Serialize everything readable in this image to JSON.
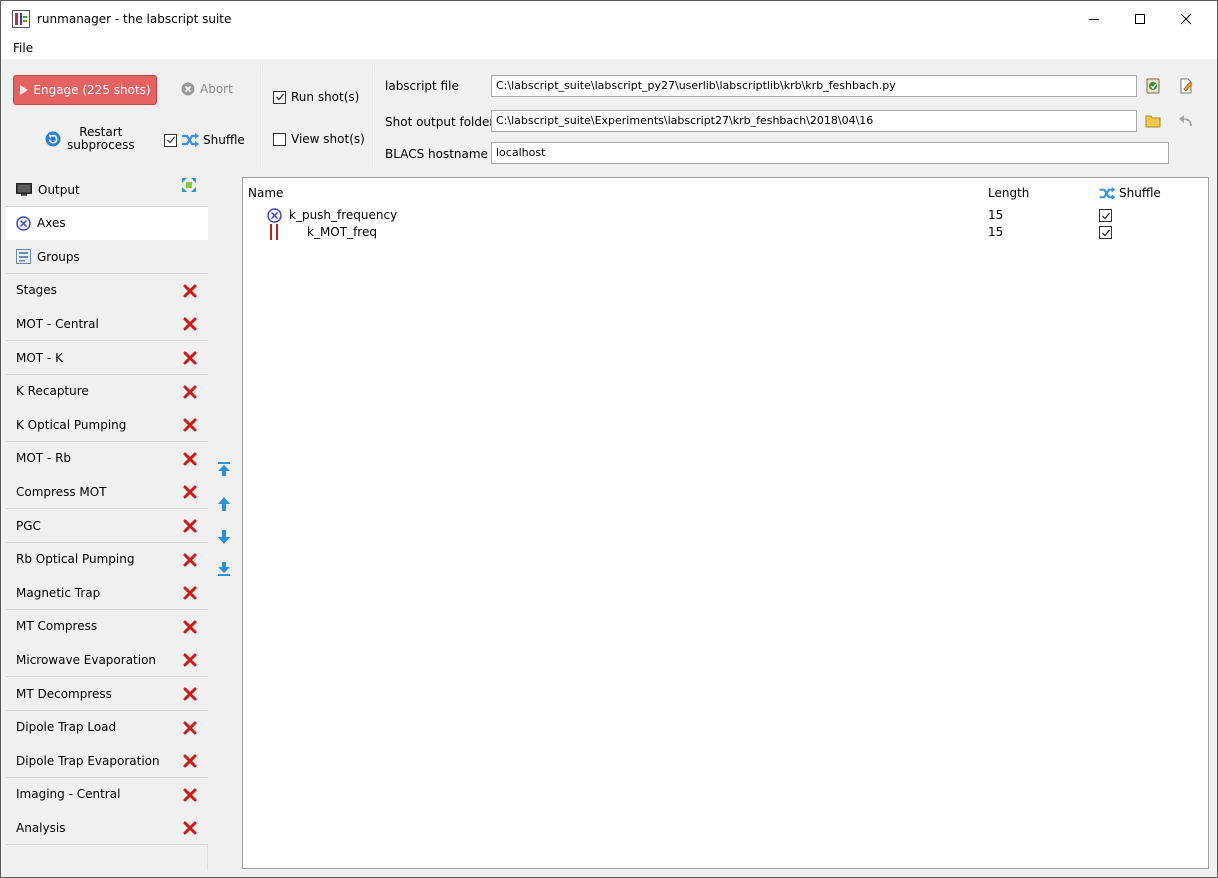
{
  "window": {
    "title": "runmanager - the labscript suite",
    "controls": [
      "minimize",
      "maximize",
      "close"
    ]
  },
  "menu": {
    "file": "File"
  },
  "toolbar": {
    "engage_label": "Engage (225 shots)",
    "abort_label": "Abort",
    "restart_label_line1": "Restart",
    "restart_label_line2": "subprocess",
    "shuffle_label": "Shuffle",
    "shuffle_checked": true,
    "run_shots_label": "Run shot(s)",
    "run_shots_checked": true,
    "view_shots_label": "View shot(s)",
    "view_shots_checked": false
  },
  "settings": {
    "labscript_file_label": "labscript file",
    "labscript_file_value": "C:\\labscript_suite\\labscript_py27\\userlib\\labscriptlib\\krb\\krb_feshbach.py",
    "shot_output_label": "Shot output folder",
    "shot_output_value": "C:\\labscript_suite\\Experiments\\labscript27\\krb_feshbach\\2018\\04\\16",
    "blacs_label": "BLACS hostname",
    "blacs_value": "localhost"
  },
  "tabs": [
    {
      "label": "Output",
      "icon": "monitor-icon",
      "closable": false
    },
    {
      "label": "Axes",
      "icon": "axes-icon",
      "closable": false,
      "active": true
    },
    {
      "label": "Groups",
      "icon": "groups-icon",
      "closable": false
    },
    {
      "label": "Stages",
      "closable": true
    },
    {
      "label": "MOT - Central",
      "closable": true
    },
    {
      "label": "MOT - K",
      "closable": true
    },
    {
      "label": "K Recapture",
      "closable": true
    },
    {
      "label": "K Optical Pumping",
      "closable": true
    },
    {
      "label": "MOT - Rb",
      "closable": true
    },
    {
      "label": "Compress MOT",
      "closable": true
    },
    {
      "label": "PGC",
      "closable": true
    },
    {
      "label": "Rb Optical Pumping",
      "closable": true
    },
    {
      "label": "Magnetic Trap",
      "closable": true
    },
    {
      "label": "MT Compress",
      "closable": true
    },
    {
      "label": "Microwave Evaporation",
      "closable": true
    },
    {
      "label": "MT Decompress",
      "closable": true
    },
    {
      "label": "Dipole Trap Load",
      "closable": true
    },
    {
      "label": "Dipole Trap Evaporation",
      "closable": true
    },
    {
      "label": "Imaging - Central",
      "closable": true
    },
    {
      "label": "Analysis",
      "closable": true
    }
  ],
  "axes_table": {
    "headers": {
      "name": "Name",
      "length": "Length",
      "shuffle": "Shuffle"
    },
    "rows": [
      {
        "name": "k_push_frequency",
        "length": "15",
        "shuffle": true,
        "icon": "outer-product-icon"
      },
      {
        "name": "k_MOT_freq",
        "length": "15",
        "shuffle": true,
        "icon": "zip-icon"
      }
    ]
  },
  "colors": {
    "engage_button": "#e66262",
    "close_x": "#d01818",
    "arrow_blue": "#2f8fd8",
    "axes_icon": "#3a48c8"
  }
}
